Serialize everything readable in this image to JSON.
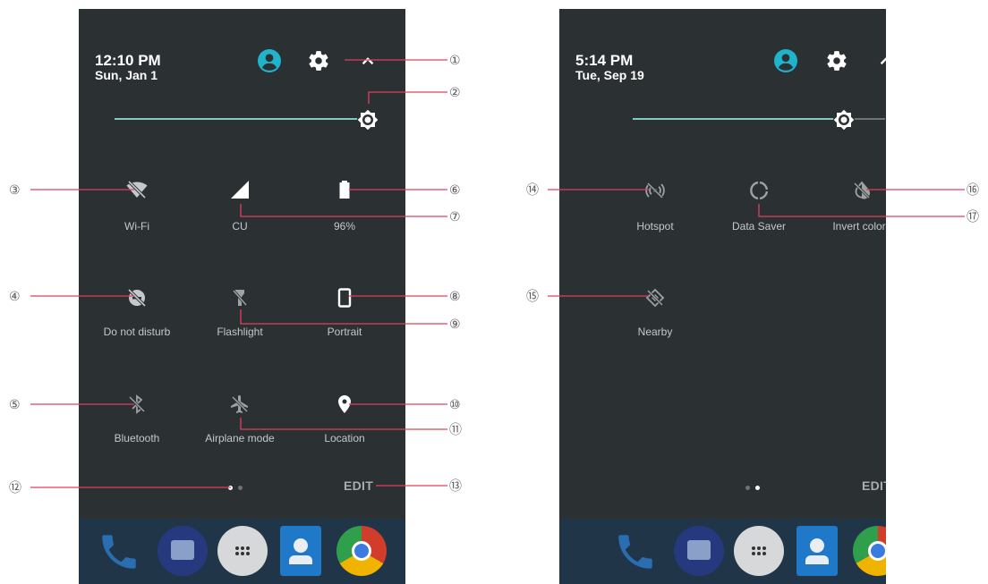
{
  "left": {
    "status": {
      "time": "12:10 PM",
      "date": "Sun, Jan 1"
    },
    "tiles": [
      {
        "label": "Wi-Fi",
        "icon": "wifi-off-icon"
      },
      {
        "label": "CU",
        "icon": "cellular-signal-icon"
      },
      {
        "label": "96%",
        "icon": "battery-icon"
      },
      {
        "label": "Do not disturb",
        "icon": "do-not-disturb-icon"
      },
      {
        "label": "Flashlight",
        "icon": "flashlight-off-icon"
      },
      {
        "label": "Portrait",
        "icon": "portrait-icon"
      },
      {
        "label": "Bluetooth",
        "icon": "bluetooth-off-icon"
      },
      {
        "label": "Airplane mode",
        "icon": "airplane-off-icon"
      },
      {
        "label": "Location",
        "icon": "location-pin-icon"
      }
    ],
    "edit_label": "EDIT",
    "brightness": 0.92
  },
  "right": {
    "status": {
      "time": "5:14 PM",
      "date": "Tue, Sep 19"
    },
    "tiles": [
      {
        "label": "Hotspot",
        "icon": "hotspot-off-icon"
      },
      {
        "label": "Data Saver",
        "icon": "data-saver-icon"
      },
      {
        "label": "Invert colors",
        "icon": "invert-colors-off-icon"
      },
      {
        "label": "Nearby",
        "icon": "nearby-off-icon"
      }
    ],
    "edit_label": "EDIT",
    "brightness": 0.84
  },
  "callouts": [
    "①",
    "②",
    "③",
    "④",
    "⑤",
    "⑥",
    "⑦",
    "⑧",
    "⑨",
    "⑩",
    "⑪",
    "⑫",
    "⑬",
    "⑭",
    "⑮",
    "⑯",
    "⑰"
  ],
  "colors": {
    "panel": "#2b3033",
    "accent": "#80cbc4",
    "avatar": "#1fb3cc",
    "callout_line": "#e0405a"
  }
}
